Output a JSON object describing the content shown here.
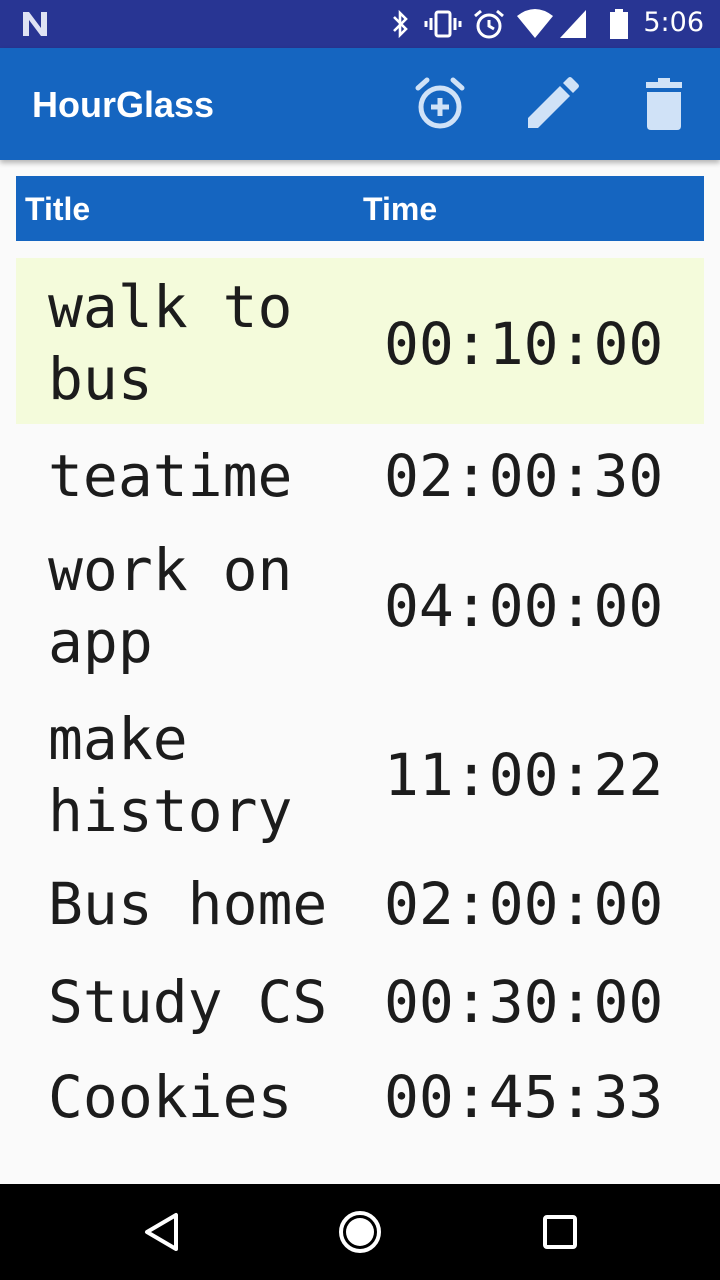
{
  "status_bar": {
    "time": "5:06",
    "icons": [
      "n-icon",
      "bluetooth-icon",
      "vibrate-icon",
      "alarm-icon",
      "wifi-icon",
      "signal-icon",
      "battery-icon"
    ]
  },
  "app_bar": {
    "title": "HourGlass",
    "actions": [
      "add-alarm-icon",
      "edit-icon",
      "delete-icon"
    ],
    "color": "#1565c0"
  },
  "table": {
    "headers": {
      "title": "Title",
      "time": "Time"
    },
    "rows": [
      {
        "title": "walk to bus",
        "time": "00:10:00",
        "selected": true
      },
      {
        "title": "teatime",
        "time": "02:00:30",
        "selected": false
      },
      {
        "title": "work on app",
        "time": "04:00:00",
        "selected": false
      },
      {
        "title": "make history",
        "time": "11:00:22",
        "selected": false
      },
      {
        "title": "Bus home",
        "time": "02:00:00",
        "selected": false
      },
      {
        "title": "Study CS",
        "time": "00:30:00",
        "selected": false
      },
      {
        "title": "Cookies",
        "time": "00:45:33",
        "selected": false
      }
    ],
    "selected_color": "#f4fbdb"
  },
  "nav_bar": {
    "buttons": [
      "back-icon",
      "home-icon",
      "recents-icon"
    ]
  }
}
